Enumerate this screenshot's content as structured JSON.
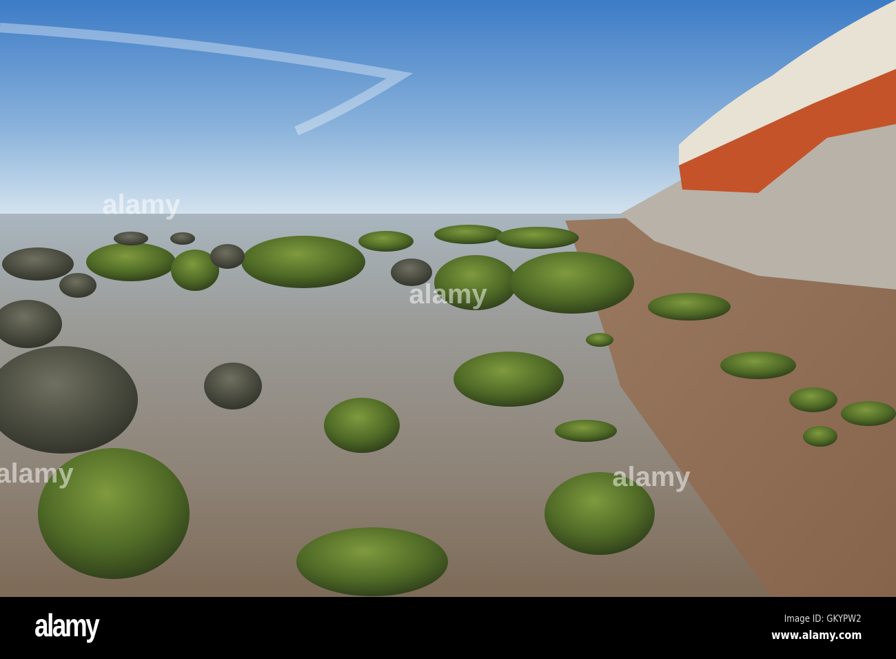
{
  "watermark": "alamy",
  "footer": {
    "logo": "alamy",
    "image_id": "Image ID: GKYPW2",
    "url": "www.alamy.com"
  },
  "colors": {
    "sky_top": "#3f7fc8",
    "horizon": "#cfe0ec",
    "water": "#8a8a88",
    "cliff_orange": "#c8532a",
    "algae": "#5d7a2c"
  }
}
